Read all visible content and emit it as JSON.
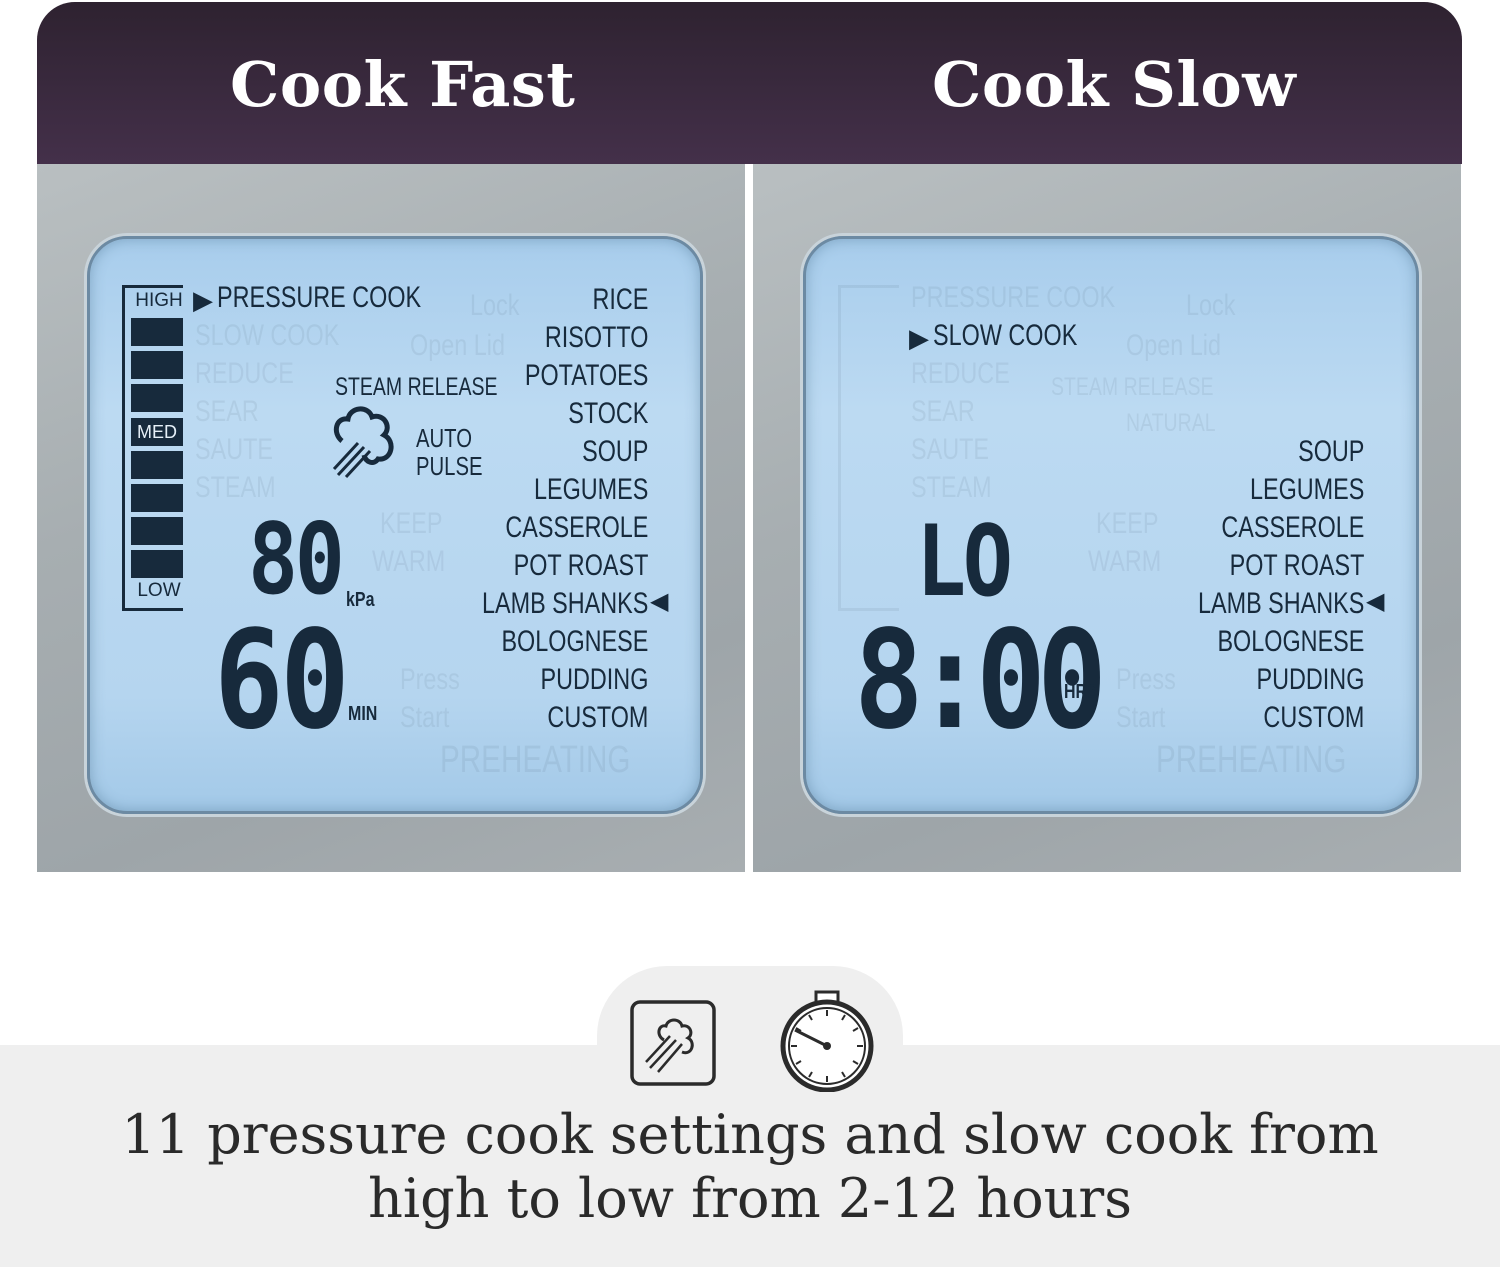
{
  "header": {
    "left_title": "Cook Fast",
    "right_title": "Cook Slow"
  },
  "colors": {
    "header_bg": "#3a2a3e",
    "lcd_text": "#172a3c",
    "lcd_bg": "#b8d7f0"
  },
  "cook_fast": {
    "level_labels": {
      "high": "HIGH",
      "med": "MED",
      "low": "LOW"
    },
    "pressure_level_segments_filled": 8,
    "active_mode": "PRESSURE COOK",
    "ghost_modes": [
      "SLOW COOK",
      "REDUCE",
      "SEAR",
      "SAUTE",
      "STEAM"
    ],
    "steam_release": {
      "label": "STEAM RELEASE",
      "mode_line1": "AUTO",
      "mode_line2": "PULSE",
      "icon": "steam-icon"
    },
    "pressure_value": "80",
    "pressure_unit": "kPa",
    "time_value": "60",
    "time_unit": "MIN",
    "menu": [
      "RICE",
      "RISOTTO",
      "POTATOES",
      "STOCK",
      "SOUP",
      "LEGUMES",
      "CASSEROLE",
      "POT ROAST",
      "LAMB SHANKS",
      "BOLOGNESE",
      "PUDDING",
      "CUSTOM"
    ],
    "selected_menu": "LAMB SHANKS",
    "ghost_labels": [
      "Lock",
      "Open Lid",
      "KEEP",
      "WARM",
      "Press",
      "Start",
      "PREHEATING"
    ]
  },
  "cook_slow": {
    "active_mode": "SLOW COOK",
    "temp_setting": "LO",
    "time_value": "8:00",
    "time_unit": "HRS",
    "menu": [
      "SOUP",
      "LEGUMES",
      "CASSEROLE",
      "POT ROAST",
      "LAMB SHANKS",
      "BOLOGNESE",
      "PUDDING",
      "CUSTOM"
    ],
    "selected_menu": "LAMB SHANKS",
    "ghost_labels": [
      "PRESSURE COOK",
      "REDUCE",
      "SEAR",
      "SAUTE",
      "STEAM",
      "Lock",
      "Open Lid",
      "STEAM RELEASE",
      "NATURAL",
      "KEEP",
      "WARM",
      "Press",
      "Start",
      "PREHEATING"
    ]
  },
  "features": {
    "icons": [
      "steam-release-icon",
      "stopwatch-icon"
    ],
    "caption_line1": "11 pressure cook settings and slow cook from",
    "caption_line2": "high to low from 2-12 hours"
  }
}
